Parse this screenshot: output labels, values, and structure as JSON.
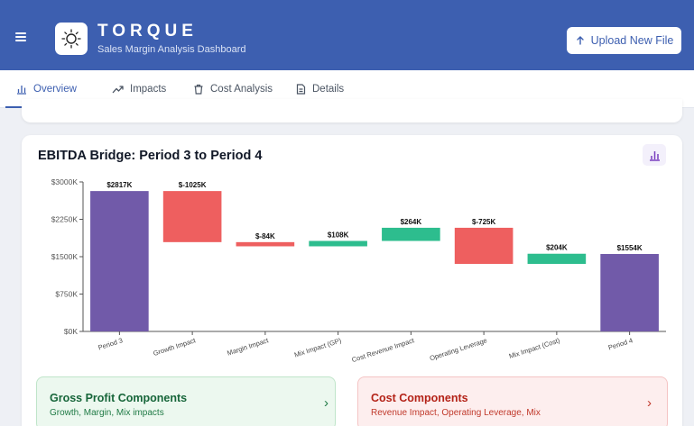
{
  "header": {
    "brand_title": "TORQUE",
    "brand_subtitle": "Sales Margin Analysis Dashboard",
    "upload_label": "Upload New File",
    "bg_color": "#3d5fb0"
  },
  "tabs": [
    {
      "label": "Overview",
      "icon": "bar-chart-icon",
      "active": true
    },
    {
      "label": "Impacts",
      "icon": "trending-up-icon",
      "active": false
    },
    {
      "label": "Cost Analysis",
      "icon": "trash-icon",
      "active": false
    },
    {
      "label": "Details",
      "icon": "document-icon",
      "active": false
    }
  ],
  "chart_card": {
    "title": "EBITDA Bridge: Period 3 to Period 4"
  },
  "chart_data": {
    "type": "bar",
    "subtype": "waterfall",
    "title": "EBITDA Bridge: Period 3 to Period 4",
    "xlabel": "",
    "ylabel": "",
    "ylim": [
      0,
      3000
    ],
    "yticks": [
      "$0K",
      "$750K",
      "$1500K",
      "$2250K",
      "$3000K"
    ],
    "ytick_values": [
      0,
      750,
      1500,
      2250,
      3000
    ],
    "grid": false,
    "colors": {
      "total": "#715aa9",
      "negative": "#ee5f5f",
      "positive": "#2dbd8e"
    },
    "bars": [
      {
        "category": "Period 3",
        "value": 2817,
        "label": "$2817K",
        "kind": "total"
      },
      {
        "category": "Growth Impact",
        "value": -1025,
        "label": "$-1025K",
        "kind": "negative"
      },
      {
        "category": "Margin Impact",
        "value": -84,
        "label": "$-84K",
        "kind": "negative"
      },
      {
        "category": "Mix Impact (GP)",
        "value": 108,
        "label": "$108K",
        "kind": "positive"
      },
      {
        "category": "Cost Revenue Impact",
        "value": 264,
        "label": "$264K",
        "kind": "positive"
      },
      {
        "category": "Operating Leverage",
        "value": -725,
        "label": "$-725K",
        "kind": "negative"
      },
      {
        "category": "Mix Impact (Cost)",
        "value": 204,
        "label": "$204K",
        "kind": "positive"
      },
      {
        "category": "Period 4",
        "value": 1554,
        "label": "$1554K",
        "kind": "total"
      }
    ]
  },
  "components": {
    "gross_profit": {
      "title": "Gross Profit Components",
      "subtitle": "Growth, Margin, Mix impacts"
    },
    "cost": {
      "title": "Cost Components",
      "subtitle": "Revenue Impact, Operating Leverage, Mix"
    }
  }
}
